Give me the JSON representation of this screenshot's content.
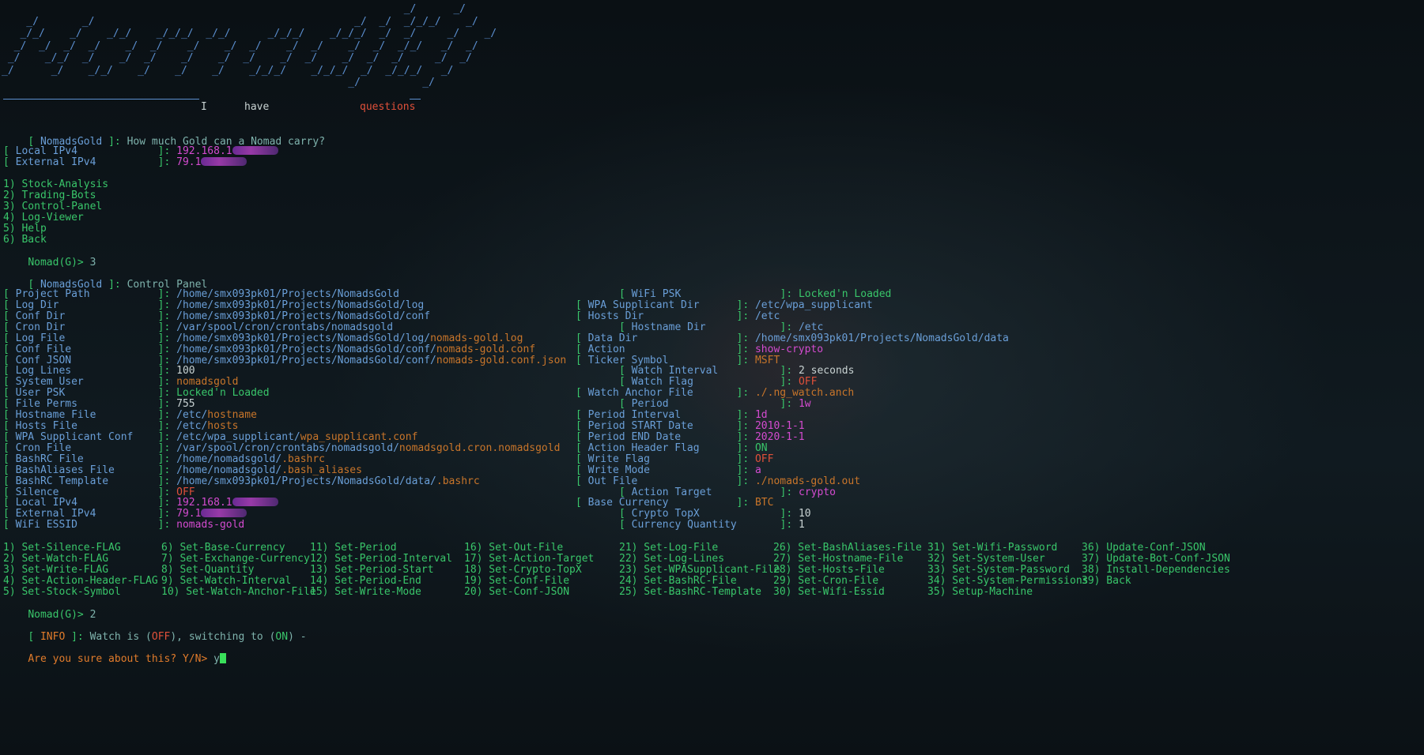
{
  "banner": {
    "art": "                                                                 _/      _/\n    _/       _/                                          _/  _/  _/_/_/    _/\n   _/_/    _/    _/_/    _/_/_/  _/_/      _/_/_/    _/_/_/  _/  _/     _/    _/\n  _/  _/  _/  _/    _/  _/    _/    _/  _/    _/  _/    _/  _/  _/_/   _/  _/\n _/    _/_/  _/    _/  _/    _/    _/  _/    _/  _/    _/  _/  _/     _/  _/\n_/      _/    _/_/    _/    _/    _/    _/_/_/    _/_/_/  _/  _/_/_/   _/\n                                                        _/          _/",
    "tag_i": "I",
    "tag_have": "have",
    "tag_questions": "questions"
  },
  "header1": {
    "label": "NomadsGold",
    "text": "How much Gold can a Nomad carry?"
  },
  "net1": [
    {
      "label": "Local IPv4",
      "value": "192.168.1"
    },
    {
      "label": "External IPv4",
      "value": "79.1"
    }
  ],
  "menu": [
    "1) Stock-Analysis",
    "2) Trading-Bots",
    "3) Control-Panel",
    "4) Log-Viewer",
    "5) Help",
    "6) Back"
  ],
  "prompt1": {
    "ps": "Nomad(G)>",
    "input": "3"
  },
  "header2": {
    "label": "NomadsGold",
    "text": "Control Panel"
  },
  "left_rows": [
    {
      "label": "Project Path",
      "value": "/home/smx093pk01/Projects/NomadsGold",
      "suffix": ""
    },
    {
      "label": "Log Dir",
      "value": "/home/smx093pk01/Projects/NomadsGold/log",
      "suffix": ""
    },
    {
      "label": "Conf Dir",
      "value": "/home/smx093pk01/Projects/NomadsGold/conf",
      "suffix": ""
    },
    {
      "label": "Cron Dir",
      "value": "/var/spool/cron/crontabs/nomadsgold",
      "suffix": ""
    },
    {
      "label": "Log File",
      "value": "/home/smx093pk01/Projects/NomadsGold/log/",
      "suffix": "nomads-gold.log"
    },
    {
      "label": "Conf File",
      "value": "/home/smx093pk01/Projects/NomadsGold/conf/",
      "suffix": "nomads-gold.conf"
    },
    {
      "label": "Conf JSON",
      "value": "/home/smx093pk01/Projects/NomadsGold/conf/",
      "suffix": "nomads-gold.conf.json"
    },
    {
      "label": "Log Lines",
      "value": "100",
      "suffix": ""
    },
    {
      "label": "System User",
      "value": "",
      "suffix": "nomadsgold"
    },
    {
      "label": "User PSK",
      "value": "",
      "suffix": "",
      "green": "Locked'n Loaded"
    },
    {
      "label": "File Perms",
      "value": "755",
      "suffix": ""
    },
    {
      "label": "Hostname File",
      "value": "/etc/",
      "suffix": "hostname"
    },
    {
      "label": "Hosts File",
      "value": "/etc/",
      "suffix": "hosts"
    },
    {
      "label": "WPA Supplicant Conf",
      "value": "/etc/wpa_supplicant/",
      "suffix": "wpa_supplicant.conf"
    },
    {
      "label": "Cron File",
      "value": "/var/spool/cron/crontabs/nomadsgold/",
      "suffix": "nomadsgold.cron.nomadsgold"
    },
    {
      "label": "BashRC File",
      "value": "/home/nomadsgold/",
      "suffix": ".bashrc"
    },
    {
      "label": "BashAliases File",
      "value": "/home/nomadsgold/",
      "suffix": ".bash_aliases"
    },
    {
      "label": "BashRC Template",
      "value": "/home/smx093pk01/Projects/NomadsGold/data/",
      "suffix": ".bashrc"
    },
    {
      "label": "Silence",
      "value": "",
      "suffix": "",
      "red": "OFF"
    },
    {
      "label": "Local IPv4",
      "value": "",
      "suffix": "",
      "mag": "192.168.1"
    },
    {
      "label": "External IPv4",
      "value": "",
      "suffix": "",
      "mag": "79.1"
    },
    {
      "label": "WiFi ESSID",
      "value": "",
      "suffix": "",
      "mag": "nomads-gold"
    }
  ],
  "right_rows": [
    {
      "label": "WiFi PSK",
      "indent": true,
      "value": "Locked'n Loaded",
      "color": "green"
    },
    {
      "label": "WPA Supplicant Dir",
      "indent": false,
      "value": "/etc/wpa_supplicant",
      "color": "blue"
    },
    {
      "label": "Hosts Dir",
      "indent": false,
      "value": "/etc",
      "color": "blue"
    },
    {
      "label": "Hostname Dir",
      "indent": true,
      "value": "/etc",
      "color": "blue"
    },
    {
      "label": "Data Dir",
      "indent": false,
      "value": "/home/smx093pk01/Projects/NomadsGold/data",
      "color": "blue"
    },
    {
      "label": "Action",
      "indent": false,
      "value": "show-crypto",
      "color": "mag"
    },
    {
      "label": "Ticker Symbol",
      "indent": false,
      "value": "MSFT",
      "color": "orange"
    },
    {
      "label": "Watch Interval",
      "indent": true,
      "value": "2 seconds",
      "color": "white"
    },
    {
      "label": "Watch Flag",
      "indent": true,
      "value": "OFF",
      "color": "red"
    },
    {
      "label": "Watch Anchor File",
      "indent": false,
      "value": "./.ng_watch.anch",
      "color": "orange"
    },
    {
      "label": "Period",
      "indent": true,
      "value": "1w",
      "color": "mag"
    },
    {
      "label": "Period Interval",
      "indent": false,
      "value": "1d",
      "color": "mag"
    },
    {
      "label": "Period START Date",
      "indent": false,
      "value": "2010-1-1",
      "color": "mag"
    },
    {
      "label": "Period END Date",
      "indent": false,
      "value": "2020-1-1",
      "color": "mag"
    },
    {
      "label": "Action Header Flag",
      "indent": false,
      "value": "ON",
      "color": "green"
    },
    {
      "label": "Write Flag",
      "indent": false,
      "value": "OFF",
      "color": "red"
    },
    {
      "label": "Write Mode",
      "indent": false,
      "value": "a",
      "color": "mag"
    },
    {
      "label": "Out File",
      "indent": false,
      "value": "./nomads-gold.out",
      "color": "orange"
    },
    {
      "label": "Action Target",
      "indent": true,
      "value": "crypto",
      "color": "mag"
    },
    {
      "label": "Base Currency",
      "indent": false,
      "value": "BTC",
      "color": "orange"
    },
    {
      "label": "Crypto TopX",
      "indent": true,
      "value": "10",
      "color": "white"
    },
    {
      "label": "Currency Quantity",
      "indent": true,
      "value": "1",
      "color": "white"
    }
  ],
  "commands": [
    [
      "1) Set-Silence-FLAG",
      "2) Set-Watch-FLAG",
      "3) Set-Write-FLAG",
      "4) Set-Action-Header-FLAG",
      "5) Set-Stock-Symbol"
    ],
    [
      "6) Set-Base-Currency",
      "7) Set-Exchange-Currency",
      "8) Set-Quantity",
      "9) Set-Watch-Interval",
      "10) Set-Watch-Anchor-File"
    ],
    [
      "11) Set-Period",
      "12) Set-Period-Interval",
      "13) Set-Period-Start",
      "14) Set-Period-End",
      "15) Set-Write-Mode"
    ],
    [
      "16) Set-Out-File",
      "17) Set-Action-Target",
      "18) Set-Crypto-TopX",
      "19) Set-Conf-File",
      "20) Set-Conf-JSON"
    ],
    [
      "21) Set-Log-File",
      "22) Set-Log-Lines",
      "23) Set-WPASupplicant-File",
      "24) Set-BashRC-File",
      "25) Set-BashRC-Template"
    ],
    [
      "26) Set-BashAliases-File",
      "27) Set-Hostname-File",
      "28) Set-Hosts-File",
      "29) Set-Cron-File",
      "30) Set-Wifi-Essid"
    ],
    [
      "31) Set-Wifi-Password",
      "32) Set-System-User",
      "33) Set-System-Password",
      "34) Set-System-Permissions",
      "35) Setup-Machine"
    ],
    [
      "36) Update-Conf-JSON",
      "37) Update-Bot-Conf-JSON",
      "38) Install-Dependencies",
      "39) Back",
      ""
    ]
  ],
  "prompt2": {
    "ps": "Nomad(G)>",
    "input": "2"
  },
  "info": {
    "tag": "INFO",
    "pre": "Watch is (",
    "off": "OFF",
    "mid": "), switching to (",
    "on": "ON",
    "post": ") -"
  },
  "confirm": {
    "text": "Are you sure about this? Y/N>",
    "input": "y"
  },
  "colors": {
    "background": "#0e1419",
    "accent_green": "#39c66a",
    "accent_blue": "#6a9fd8",
    "magenta": "#d44bd0",
    "orange": "#c8752a",
    "red": "#e0503a"
  }
}
